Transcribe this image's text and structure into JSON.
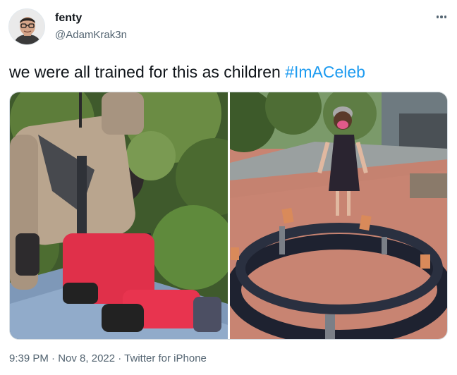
{
  "user": {
    "display_name": "fenty",
    "handle": "@AdamKrak3n"
  },
  "tweet": {
    "text": "we were all trained for this as children ",
    "hashtag": "#ImACeleb"
  },
  "media": {
    "count": 2
  },
  "footer": {
    "time": "9:39 PM",
    "separator": " · ",
    "date": "Nov 8, 2022",
    "source": "Twitter for iPhone"
  },
  "colors": {
    "accent": "#1d9bf0",
    "text": "#0f1419",
    "muted": "#536471"
  },
  "icons": {
    "more": "more-horizontal-icon"
  }
}
